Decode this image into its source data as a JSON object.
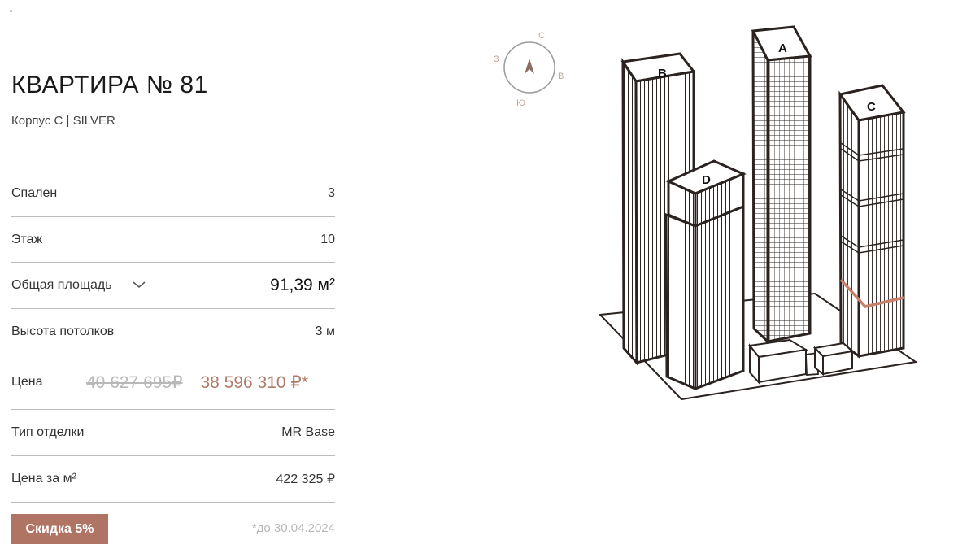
{
  "apartment": {
    "title": "КВАРТИРА № 81",
    "building": "Корпус C | SILVER"
  },
  "specs": {
    "bedrooms_label": "Спален",
    "bedrooms_value": "3",
    "floor_label": "Этаж",
    "floor_value": "10",
    "area_label": "Общая площадь",
    "area_value": "91,39 м²",
    "ceiling_label": "Высота потолков",
    "ceiling_value": "3 м",
    "price_label": "Цена",
    "price_old": "40 627 695₽",
    "price_new": "38 596 310 ₽*",
    "finish_label": "Тип отделки",
    "finish_value": "MR Base",
    "price_per_m2_label": "Цена за м²",
    "price_per_m2_value": "422 325 ₽"
  },
  "promo": {
    "discount_label": "Скидка 5%",
    "valid_until": "*до 30.04.2024"
  },
  "compass": {
    "north": "С",
    "east": "В",
    "south": "Ю",
    "west": "З"
  },
  "towers": {
    "a": "A",
    "b": "B",
    "c": "C",
    "d": "D"
  },
  "colors": {
    "accent": "#b07464",
    "line": "#2b2320",
    "compass": "#c0a59a"
  }
}
